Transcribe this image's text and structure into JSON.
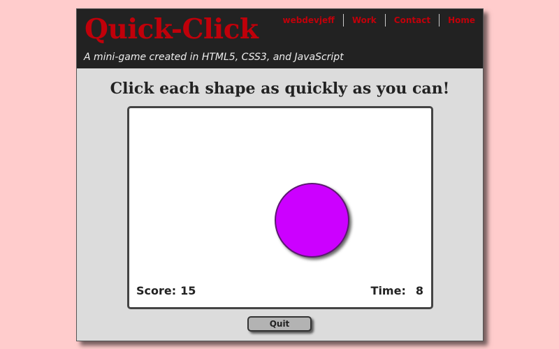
{
  "header": {
    "logo": "Quick-Click",
    "tagline": "A mini-game created in HTML5, CSS3, and JavaScript",
    "nav": [
      {
        "label": "webdevjeff"
      },
      {
        "label": "Work"
      },
      {
        "label": "Contact"
      },
      {
        "label": "Home"
      }
    ]
  },
  "game": {
    "instructions": "Click each shape as quickly as you can!",
    "score_label": "Score:",
    "score": "15",
    "time_label": "Time:",
    "time": "8",
    "shape": {
      "kind": "circle",
      "color": "#cc00ff"
    },
    "quit_label": "Quit"
  },
  "colors": {
    "page_background": "#ffcccc",
    "header_background": "#222222",
    "accent": "#c0000a",
    "content_background": "#dcdcdc"
  }
}
